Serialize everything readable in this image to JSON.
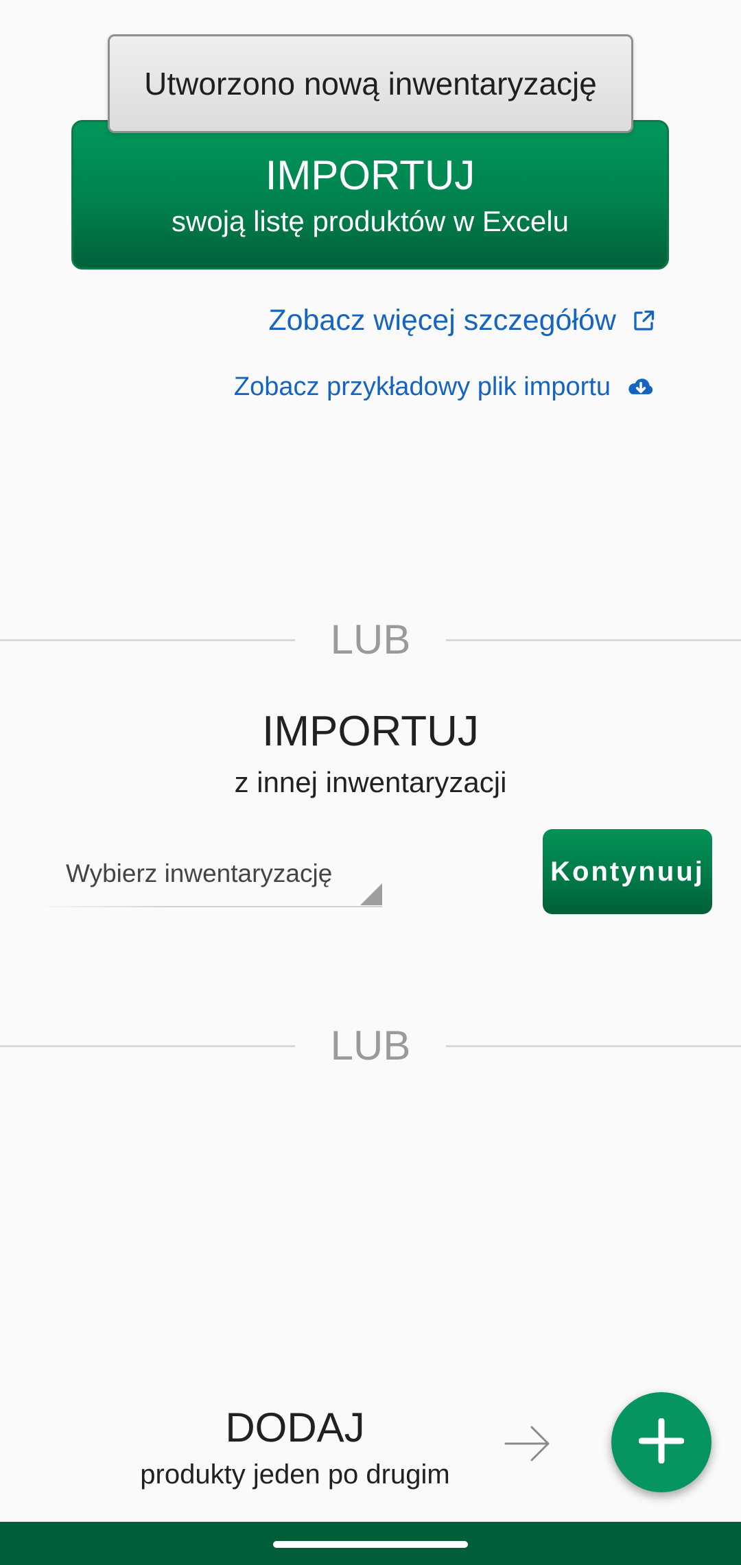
{
  "toast": {
    "message": "Utworzono nową inwentaryzację"
  },
  "excel_import": {
    "title": "IMPORTUJ",
    "subtitle": "swoją listę produktów w Excelu"
  },
  "links": {
    "details": "Zobacz więcej szczegółów",
    "sample_file": "Zobacz przykładowy plik importu"
  },
  "separator_label": "LUB",
  "import_other": {
    "title": "IMPORTUJ",
    "subtitle": "z innej inwentaryzacji",
    "dropdown_placeholder": "Wybierz inwentaryzację",
    "continue_label": "Kontynuuj"
  },
  "add_manual": {
    "title": "DODAJ",
    "subtitle": "produkty jeden po drugim"
  },
  "icons": {
    "details": "external-link-icon",
    "sample_file": "cloud-download-icon",
    "arrow": "arrow-right-icon",
    "fab": "plus-icon"
  },
  "colors": {
    "primary_green": "#01824e",
    "dark_green": "#005f38",
    "link_blue": "#1565c0",
    "fab_green": "#069460"
  }
}
